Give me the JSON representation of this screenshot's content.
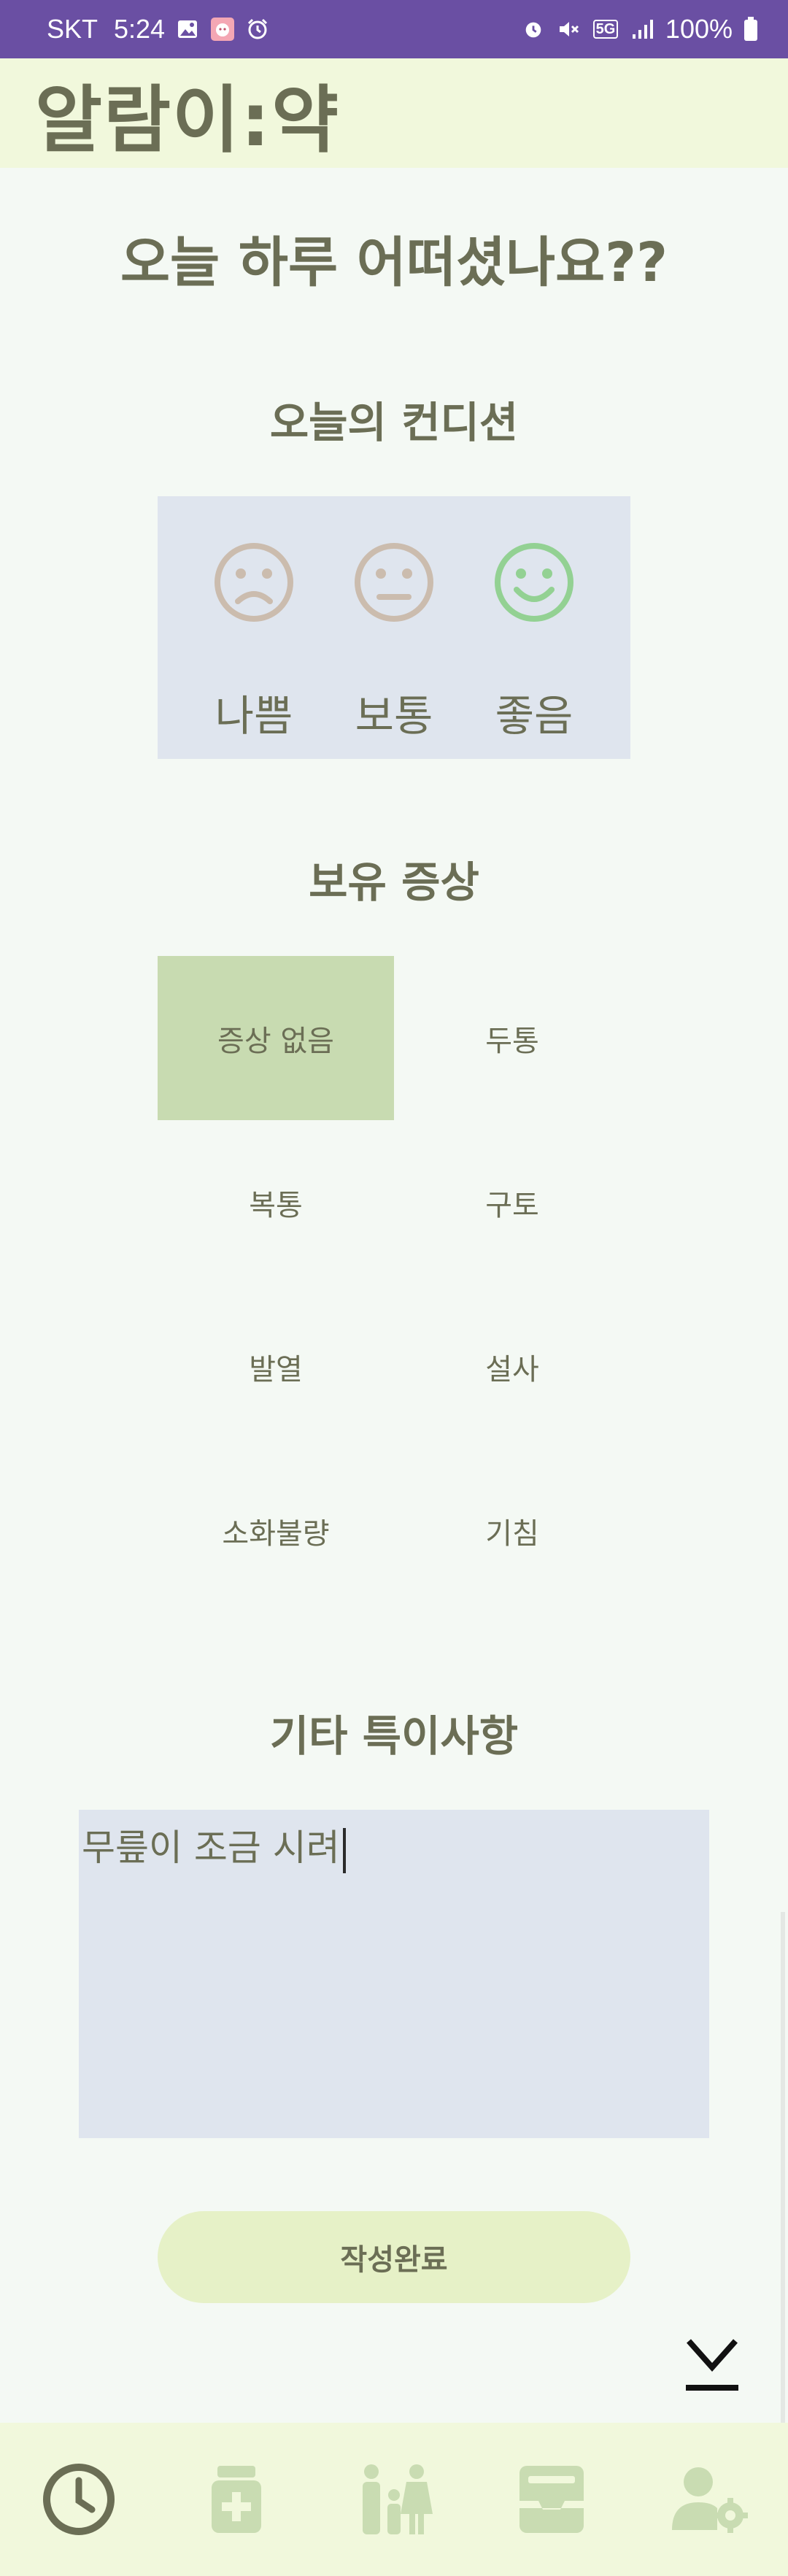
{
  "status_bar": {
    "carrier": "SKT",
    "time": "5:24",
    "network": "5G",
    "battery": "100%",
    "left_icons": [
      "gallery-icon",
      "app-notification-icon",
      "alarm-clock-icon"
    ],
    "right_icons": [
      "alarm-icon",
      "mute-icon",
      "5g-icon",
      "signal-icon",
      "battery-icon"
    ]
  },
  "app": {
    "title": "알람이:약"
  },
  "question": "오늘 하루 어떠셨나요??",
  "condition": {
    "title": "오늘의 컨디션",
    "options": [
      {
        "label": "나쁨",
        "icon": "sad-face-icon",
        "selected": false
      },
      {
        "label": "보통",
        "icon": "neutral-face-icon",
        "selected": false
      },
      {
        "label": "좋음",
        "icon": "happy-face-icon",
        "selected": true
      }
    ],
    "colors": {
      "unselected": "#cbbcae",
      "selected": "#93d193"
    }
  },
  "symptoms": {
    "title": "보유 증상",
    "items": [
      {
        "label": "증상 없음",
        "selected": true
      },
      {
        "label": "두통",
        "selected": false
      },
      {
        "label": "복통",
        "selected": false
      },
      {
        "label": "구토",
        "selected": false
      },
      {
        "label": "발열",
        "selected": false
      },
      {
        "label": "설사",
        "selected": false
      },
      {
        "label": "소화불량",
        "selected": false
      },
      {
        "label": "기침",
        "selected": false
      }
    ],
    "selected_color": "#c8dbb1"
  },
  "notes": {
    "title": "기타 특이사항",
    "value": "무릎이 조금 시려"
  },
  "submit": {
    "label": "작성완료"
  },
  "bottom_nav": {
    "items": [
      {
        "icon": "clock-icon",
        "active": true
      },
      {
        "icon": "medicine-bottle-icon",
        "active": false
      },
      {
        "icon": "family-icon",
        "active": false
      },
      {
        "icon": "inbox-icon",
        "active": false
      },
      {
        "icon": "user-settings-icon",
        "active": false
      }
    ]
  },
  "colors": {
    "status_bar": "#6a4fa3",
    "header_bg": "#f1f8dc",
    "page_bg": "#f4f9f4",
    "text": "#6b6e55",
    "panel_bg": "#dfe5ee",
    "button_bg": "#e6f1c7",
    "nav_active": "#6b6e55",
    "nav_inactive": "#c9dcb2"
  }
}
